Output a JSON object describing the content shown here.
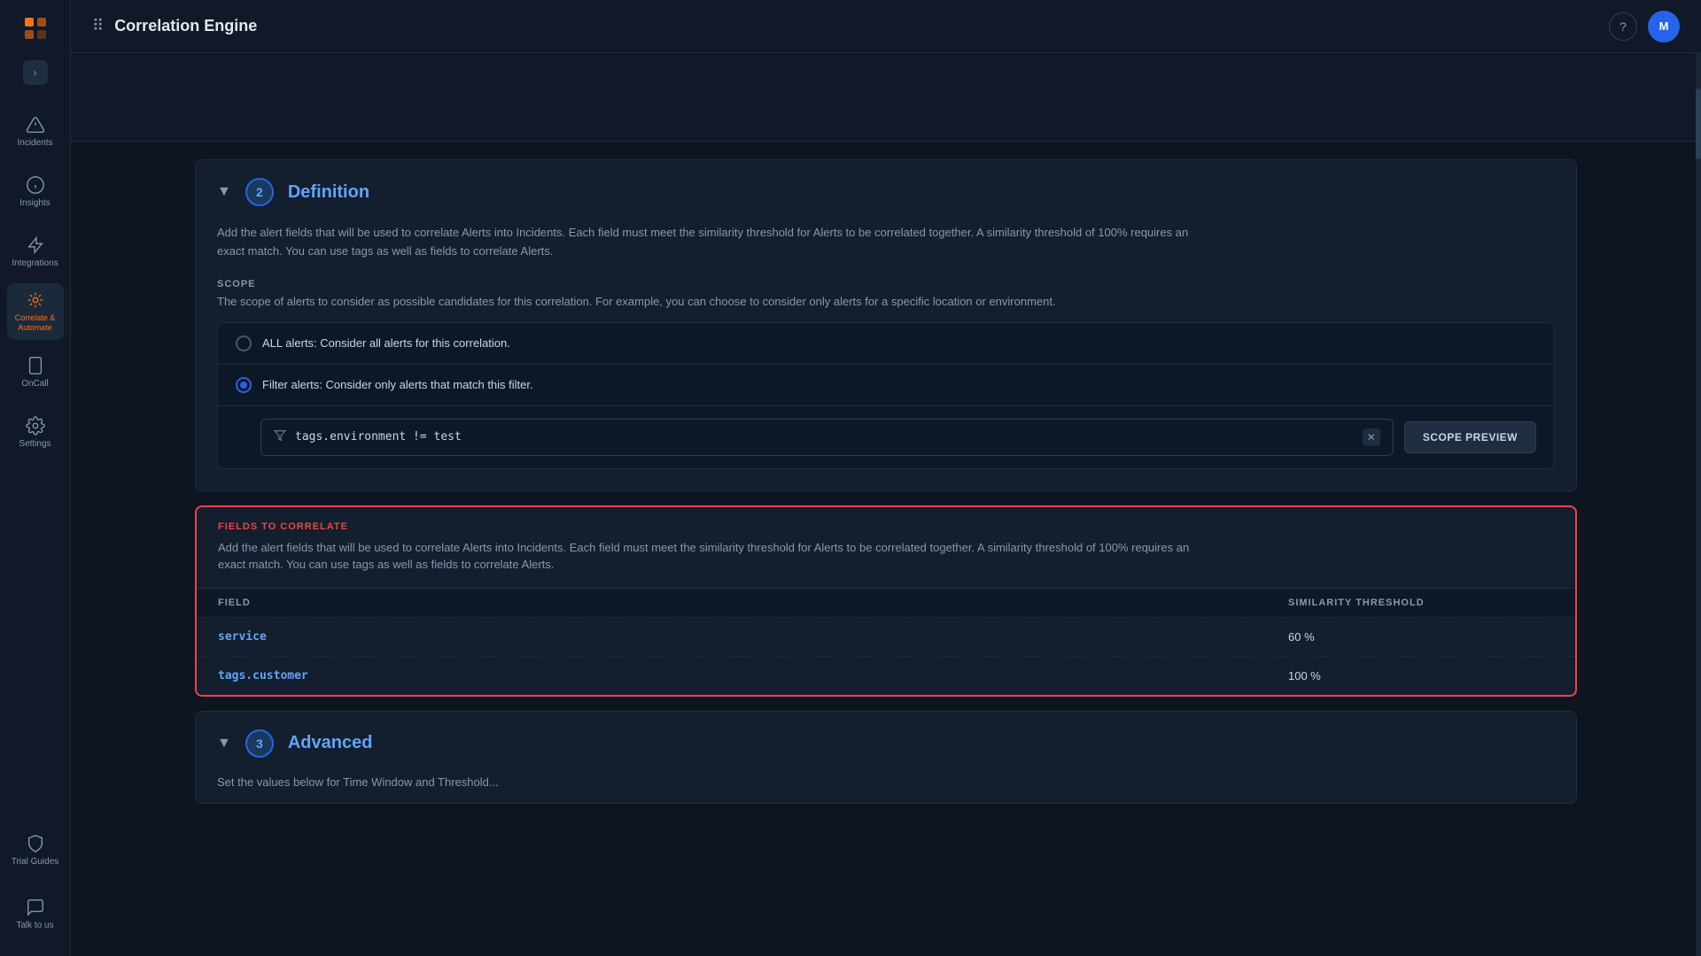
{
  "app": {
    "title": "Correlation Engine",
    "header_icon": "⠿"
  },
  "sidebar": {
    "items": [
      {
        "id": "incidents",
        "label": "Incidents",
        "icon": "incidents"
      },
      {
        "id": "insights",
        "label": "Insights",
        "icon": "insights"
      },
      {
        "id": "integrations",
        "label": "Integrations",
        "icon": "integrations"
      },
      {
        "id": "correlate",
        "label": "Correlate &\nAutomate",
        "icon": "correlate",
        "active": true
      },
      {
        "id": "oncall",
        "label": "OnCall",
        "icon": "oncall"
      },
      {
        "id": "settings",
        "label": "Settings",
        "icon": "settings"
      }
    ],
    "bottom": [
      {
        "id": "trial-guides",
        "label": "Trial Guides",
        "icon": "trial-guides"
      },
      {
        "id": "talk-to-us",
        "label": "Talk to us",
        "icon": "talk-to-us"
      }
    ]
  },
  "sections": {
    "definition": {
      "number": "2",
      "title": "Definition",
      "description": "Add the alert fields that will be used to correlate Alerts into Incidents. Each field must meet the similarity threshold for Alerts to be correlated together. A similarity threshold of 100% requires an exact match. You can use tags as well as fields to correlate Alerts.",
      "scope": {
        "label": "SCOPE",
        "description": "The scope of alerts to consider as possible candidates for this correlation. For example, you can choose to consider only alerts for a specific location or environment.",
        "options": [
          {
            "id": "all",
            "label": "ALL alerts: Consider all alerts for this correlation.",
            "selected": false
          },
          {
            "id": "filter",
            "label": "Filter alerts: Consider only alerts that match this filter.",
            "selected": true
          }
        ],
        "filter_value": "tags.environment != test",
        "scope_preview_button": "SCOPE PREVIEW"
      },
      "fields_to_correlate": {
        "label": "FIELDS TO CORRELATE",
        "description": "Add the alert fields that will be used to correlate Alerts into Incidents. Each field must meet the similarity threshold for Alerts to be correlated together. A similarity threshold of 100% requires an exact match. You can use tags as well as fields to correlate Alerts.",
        "columns": {
          "field": "FIELD",
          "threshold": "SIMILARITY THRESHOLD"
        },
        "rows": [
          {
            "field": "service",
            "threshold": "60 %"
          },
          {
            "field": "tags.customer",
            "threshold": "100 %"
          }
        ]
      }
    },
    "advanced": {
      "number": "3",
      "title": "Advanced"
    }
  },
  "colors": {
    "accent_blue": "#60a5fa",
    "accent_orange": "#f97316",
    "accent_red": "#ef4444",
    "bg_dark": "#0f1520",
    "bg_medium": "#131e2e",
    "bg_sidebar": "#111827"
  }
}
